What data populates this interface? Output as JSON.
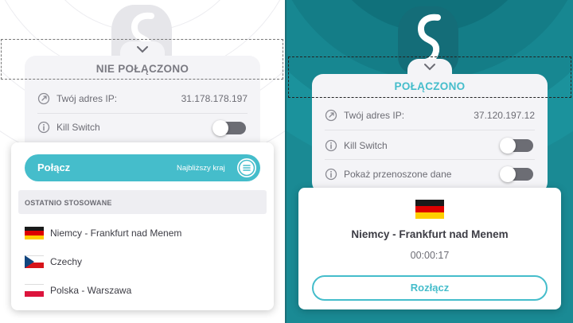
{
  "colors": {
    "accent": "#45bdcb",
    "connected_bg": "#1a8a94",
    "toggle_off": "#6c6d74"
  },
  "left": {
    "status": "NIE POŁĄCZONO",
    "ip_label": "Twój adres IP:",
    "ip_value": "31.178.178.197",
    "kill_switch_label": "Kill Switch",
    "kill_switch_on": false,
    "connect_label": "Połącz",
    "nearest_label": "Najbliższy kraj",
    "recent_header": "OSTATNIO STOSOWANE",
    "recent": [
      {
        "name": "Niemcy - Frankfurt nad Menem",
        "flag": "germany-flag-icon"
      },
      {
        "name": "Czechy",
        "flag": "czech-flag-icon"
      },
      {
        "name": "Polska - Warszawa",
        "flag": "poland-flag-icon"
      }
    ]
  },
  "right": {
    "status": "POŁĄCZONO",
    "ip_label": "Twój adres IP:",
    "ip_value": "37.120.197.12",
    "kill_switch_label": "Kill Switch",
    "kill_switch_on": false,
    "data_label": "Pokaż przenoszone dane",
    "data_on": false,
    "server": "Niemcy - Frankfurt nad Menem",
    "timer": "00:00:17",
    "disconnect_label": "Rozłącz"
  }
}
